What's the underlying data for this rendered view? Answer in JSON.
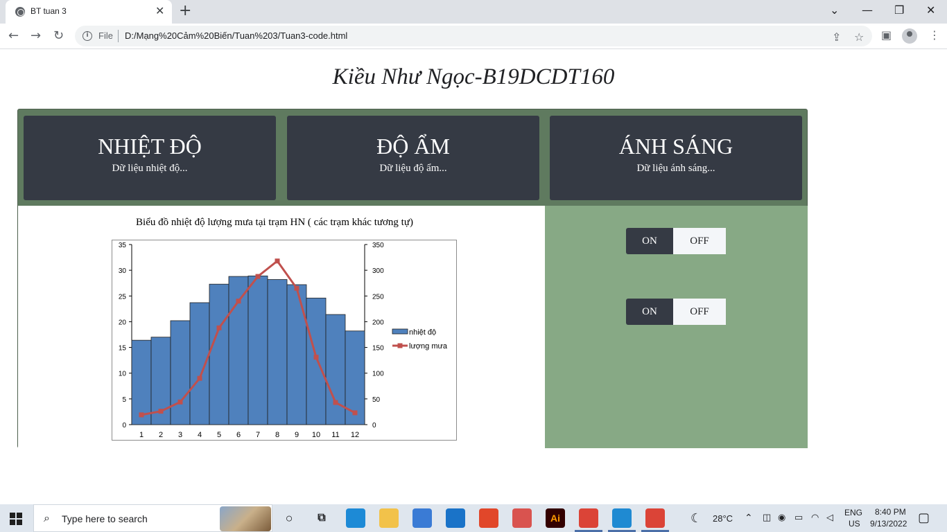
{
  "browser": {
    "tab_title": "BT tuan 3",
    "tab_close": "✕",
    "new_tab": "+",
    "omnibox_scheme": "File",
    "url": "D:/Mạng%20Cảm%20Biến/Tuan%203/Tuan3-code.html",
    "icons": [
      "globe-icon",
      "back-icon",
      "forward-icon",
      "reload-icon",
      "info-icon",
      "share-icon",
      "star-icon",
      "sidepanel-icon",
      "profile-icon",
      "menu-icon"
    ]
  },
  "page": {
    "title": "Kiều Như Ngọc-B19DCDT160",
    "cards": [
      {
        "title": "NHIỆT ĐỘ",
        "subtitle": "Dữ liệu nhiệt độ..."
      },
      {
        "title": "ĐỘ ẨM",
        "subtitle": "Dữ liệu độ ẩm..."
      },
      {
        "title": "ÁNH SÁNG",
        "subtitle": "Dữ liệu ánh sáng..."
      }
    ],
    "chart_title": "Biểu đồ nhiệt độ lượng mưa tại trạm HN ( các trạm khác tương tự)",
    "toggles": [
      {
        "on_label": "ON",
        "off_label": "OFF"
      },
      {
        "on_label": "ON",
        "off_label": "OFF"
      }
    ]
  },
  "chart_data": {
    "type": "bar",
    "title": "",
    "categories": [
      "1",
      "2",
      "3",
      "4",
      "5",
      "6",
      "7",
      "8",
      "9",
      "10",
      "11",
      "12"
    ],
    "series": [
      {
        "name": "nhiệt độ",
        "type": "bar",
        "axis": "left",
        "color": "#4f81bd",
        "values": [
          16.4,
          17.0,
          20.2,
          23.7,
          27.3,
          28.8,
          28.9,
          28.2,
          27.2,
          24.6,
          21.4,
          18.2
        ]
      },
      {
        "name": "lượng mưa",
        "type": "line",
        "axis": "right",
        "color": "#c0504d",
        "values": [
          19,
          26,
          44,
          90,
          188,
          240,
          288,
          318,
          265,
          131,
          43,
          23
        ]
      }
    ],
    "y_left": {
      "min": 0,
      "max": 35,
      "ticks": [
        0,
        5,
        10,
        15,
        20,
        25,
        30,
        35
      ]
    },
    "y_right": {
      "min": 0,
      "max": 350,
      "ticks": [
        0,
        50,
        100,
        150,
        200,
        250,
        300,
        350
      ]
    },
    "legend_position": "right"
  },
  "taskbar": {
    "search_placeholder": "Type here to search",
    "weather": "28°C",
    "language": "ENG",
    "region": "US",
    "time": "8:40 PM",
    "date": "9/13/2022",
    "apps": [
      {
        "name": "edge",
        "label": "",
        "color": "#1d8ad6"
      },
      {
        "name": "file-explorer",
        "label": "",
        "color": "#f2c24a"
      },
      {
        "name": "store",
        "label": "",
        "color": "#3a7bd5"
      },
      {
        "name": "mail",
        "label": "",
        "color": "#1a73c8"
      },
      {
        "name": "office",
        "label": "",
        "color": "#e1472a"
      },
      {
        "name": "app",
        "label": "",
        "color": "#d9534f"
      },
      {
        "name": "illustrator",
        "label": "Ai",
        "color": "#330000"
      },
      {
        "name": "chrome",
        "label": "",
        "color": "#db4437"
      },
      {
        "name": "vscode",
        "label": "",
        "color": "#1f8ad2"
      },
      {
        "name": "chrome-2",
        "label": "",
        "color": "#db4437"
      }
    ]
  }
}
